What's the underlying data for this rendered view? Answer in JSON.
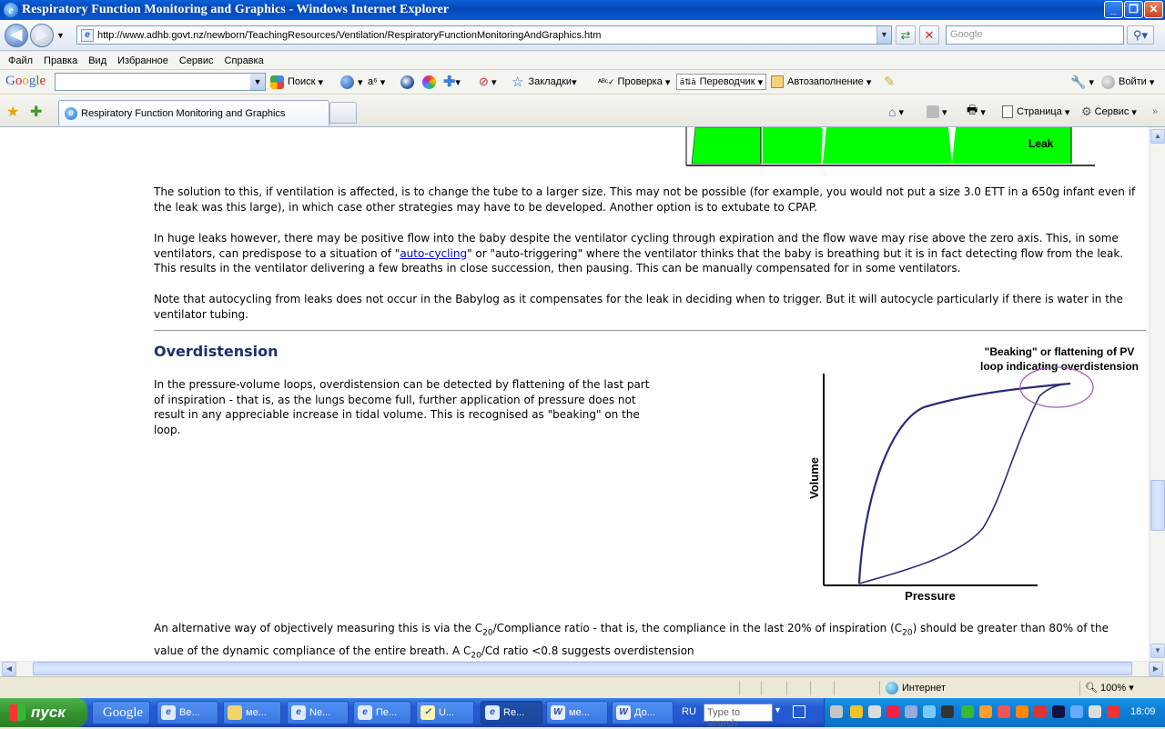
{
  "window": {
    "title": "Respiratory Function Monitoring and Graphics - Windows Internet Explorer"
  },
  "address_bar": {
    "url": "http://www.adhb.govt.nz/newborn/TeachingResources/Ventilation/RespiratoryFunctionMonitoringAndGraphics.htm",
    "search_placeholder": "Google"
  },
  "menu": {
    "items": [
      "Файл",
      "Правка",
      "Вид",
      "Избранное",
      "Сервис",
      "Справка"
    ]
  },
  "google_toolbar": {
    "logo": "Google",
    "search_label": "Поиск",
    "bookmarks_label": "Закладки",
    "spellcheck_label": "Проверка",
    "translate_label": "Переводчик",
    "autofill_label": "Автозаполнение",
    "signin_label": "Войти"
  },
  "tabs": {
    "active_title": "Respiratory Function Monitoring and Graphics"
  },
  "command_bar": {
    "page_label": "Страница",
    "tools_label": "Сервис"
  },
  "content": {
    "leak_label": "Leak",
    "paragraphs": {
      "p1": "The solution to this, if ventilation is affected, is to change the tube to a larger size.  This may not be possible (for example, you would not put a size 3.0 ETT in a 650g infant even if the leak was this large), in which case other strategies may have to be developed. Another option is to extubate to CPAP.",
      "p2_a": "In huge leaks however, there may be positive flow into the baby despite the ventilator cycling through expiration and the flow wave may rise above the zero axis.  This, in some ventilators, can predispose to a situation of \"",
      "p2_link": "auto-cycling",
      "p2_b": "\" or \"auto-triggering\" where the ventilator thinks that the baby is breathing but it is in fact detecting flow from the leak.  This results in the ventilator delivering a few breaths in close succession, then pausing. This can be manually compensated for in some ventilators.",
      "p3": "Note that autocycling from leaks does not occur in the Babylog as it compensates for the leak in deciding when to trigger.  But it will autocycle particularly if there is water in the ventilator tubing.",
      "heading": "Overdistension",
      "p4": "In the pressure-volume loops, overdistension can be detected by flattening of the last part of inspiration - that is, as the lungs become full, further application of pressure does not result in any appreciable increase in tidal volume.  This is recognised as \"beaking\" on the loop.",
      "p5_a": "An alternative way of objectively measuring this is via the C",
      "p5_sub1": "20",
      "p5_b": "/Compliance ratio - that is, the compliance in the last 20% of inspiration (C",
      "p5_sub2": "20",
      "p5_c": ") should be greater than 80% of the value of the dynamic compliance of the entire breath.  A C",
      "p5_sub3": "20",
      "p5_d": "/Cd ratio <0.8 suggests overdistension"
    },
    "pv_figure": {
      "caption_line1": "\"Beaking\" or flattening of PV",
      "caption_line2": "loop indicating overdistension",
      "ylabel": "Volume",
      "xlabel": "Pressure"
    }
  },
  "status_bar": {
    "zone": "Интернет",
    "zoom": "100%"
  },
  "taskbar": {
    "start_label": "пуск",
    "google_label": "Google",
    "tasks": [
      "Be...",
      "ме...",
      "Ne...",
      "Пе...",
      "U...",
      "Re...",
      "ме...",
      "До..."
    ],
    "lang": "RU",
    "search_placeholder": "Type to search",
    "clock": "18:09"
  },
  "colors": {
    "leak_fill": "#00ff00",
    "heading": "#1f2f6e",
    "link": "#0000cc",
    "beak_circle": "#a058b8",
    "loop_stroke": "#2a2a7a"
  }
}
